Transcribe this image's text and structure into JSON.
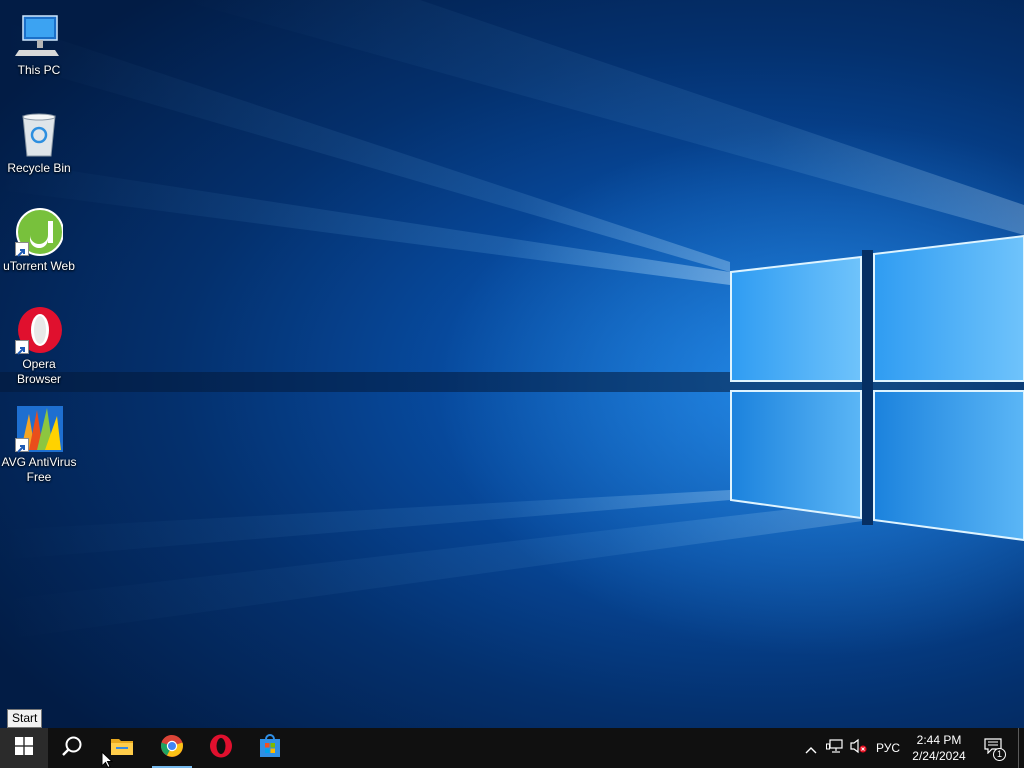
{
  "desktop": {
    "icons": [
      {
        "label": "This PC",
        "icon": "computer-icon"
      },
      {
        "label": "Recycle Bin",
        "icon": "recycle-bin-icon"
      },
      {
        "label": "uTorrent Web",
        "icon": "utorrent-icon",
        "shortcut": true
      },
      {
        "label": "Opera Browser",
        "icon": "opera-icon",
        "shortcut": true
      },
      {
        "label": "AVG AntiVirus Free",
        "icon": "avg-icon",
        "shortcut": true
      }
    ]
  },
  "tooltip": {
    "text": "Start"
  },
  "taskbar": {
    "pinned": [
      {
        "name": "start",
        "icon": "windows-logo-icon"
      },
      {
        "name": "search",
        "icon": "search-icon"
      },
      {
        "name": "file-explorer",
        "icon": "folder-icon"
      },
      {
        "name": "chrome",
        "icon": "chrome-icon",
        "active": true
      },
      {
        "name": "opera",
        "icon": "opera-icon"
      },
      {
        "name": "microsoft-store",
        "icon": "store-icon"
      }
    ],
    "tray": {
      "language": "РУС",
      "time": "2:44 PM",
      "date": "2/24/2024",
      "notification_count": "1"
    }
  },
  "colors": {
    "taskbar": "#101010",
    "accent": "#76b9ed",
    "wallpaper_glow": "#3ca0ff",
    "opera_red": "#e0102e",
    "chrome_green": "#1ea362",
    "chrome_yellow": "#fbc116",
    "chrome_red": "#db4437",
    "chrome_blue": "#4285f4"
  }
}
